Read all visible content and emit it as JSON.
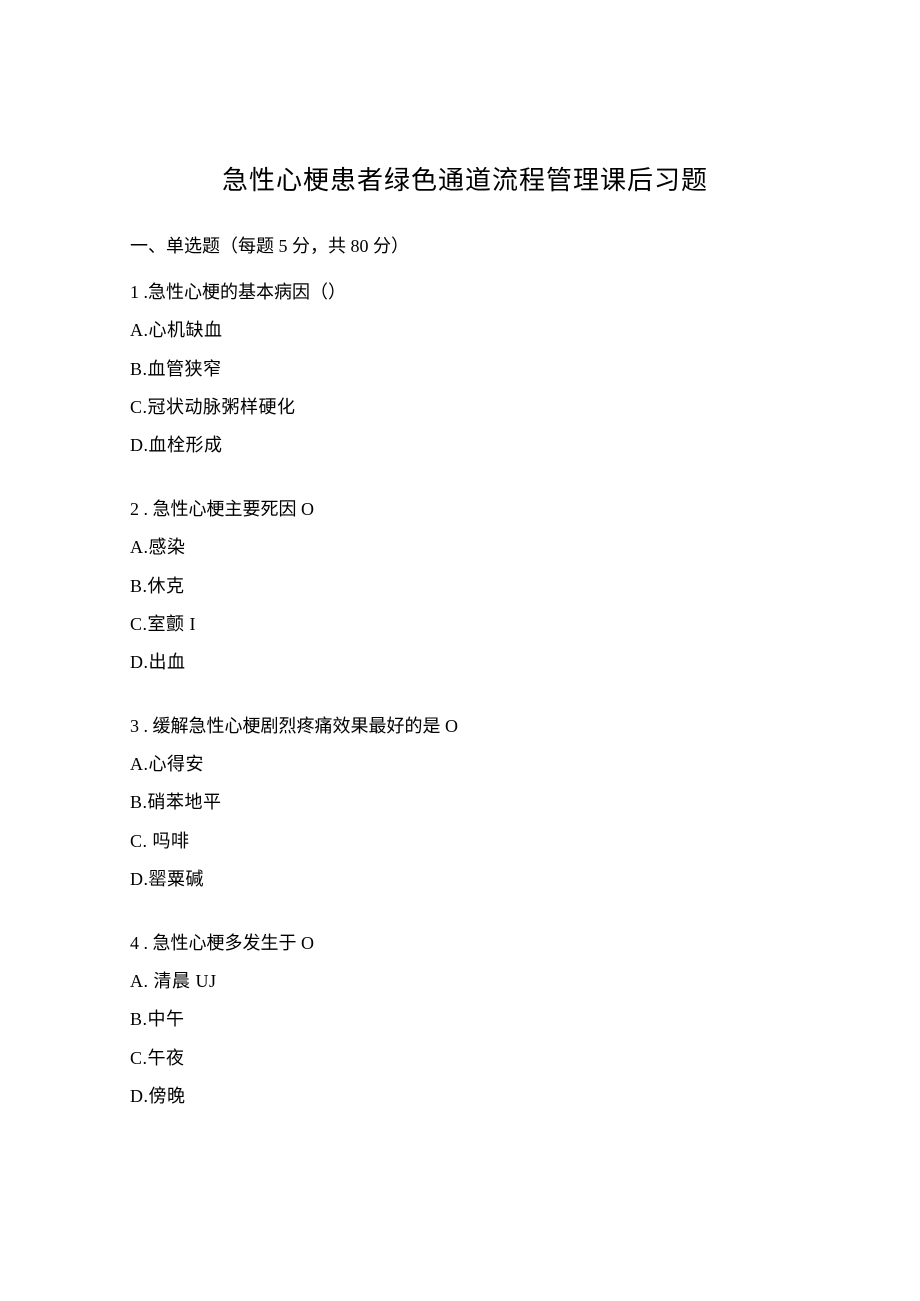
{
  "title": "急性心梗患者绿色通道流程管理课后习题",
  "section_header": "一、单选题（每题 5 分，共 80 分）",
  "questions": [
    {
      "stem": "1 .急性心梗的基本病因（）",
      "options": [
        "A.心机缺血",
        "B.血管狭窄",
        "C.冠状动脉粥样硬化",
        "D.血栓形成"
      ]
    },
    {
      "stem": "2  . 急性心梗主要死因 O",
      "options": [
        "A.感染",
        "B.休克",
        "C.室颤 I",
        "D.出血"
      ]
    },
    {
      "stem": "3  . 缓解急性心梗剧烈疼痛效果最好的是 O",
      "options": [
        "A.心得安",
        "B.硝苯地平",
        "C. 吗啡",
        "D.罂粟碱"
      ]
    },
    {
      "stem": "4  . 急性心梗多发生于 O",
      "options": [
        "A. 清晨 UJ",
        "B.中午",
        "C.午夜",
        "D.傍晚"
      ]
    }
  ]
}
